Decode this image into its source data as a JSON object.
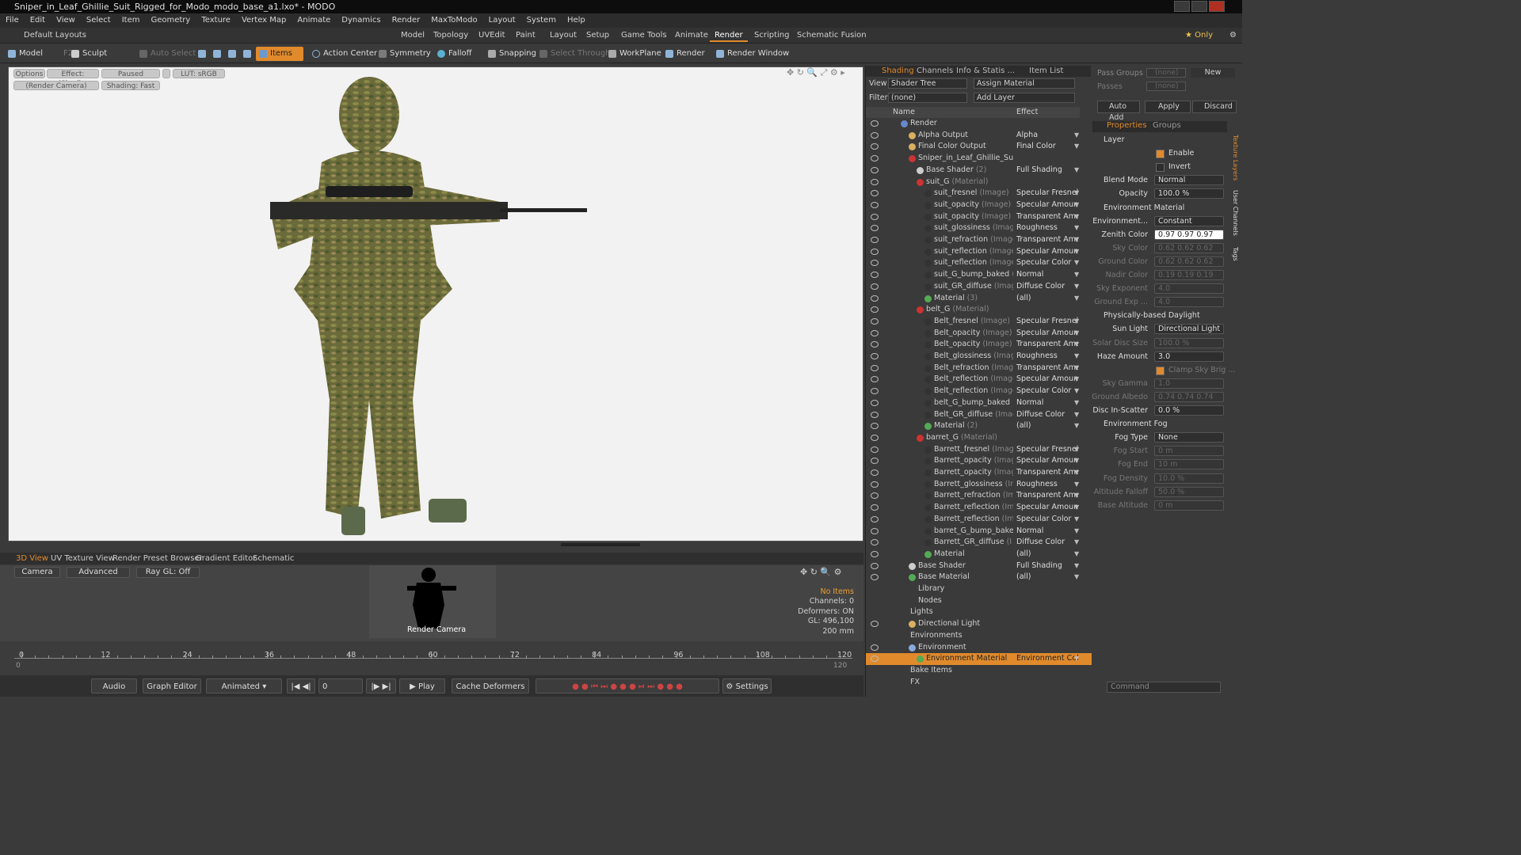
{
  "window": {
    "title": "Sniper_in_Leaf_Ghillie_Suit_Rigged_for_Modo_modo_base_a1.lxo* - MODO"
  },
  "menu": [
    "File",
    "Edit",
    "View",
    "Select",
    "Item",
    "Geometry",
    "Texture",
    "Vertex Map",
    "Animate",
    "Dynamics",
    "Render",
    "MaxToModo",
    "Layout",
    "System",
    "Help"
  ],
  "layouts": {
    "default": "Default Layouts",
    "tabs": [
      "Model",
      "Topology",
      "UVEdit",
      "Paint",
      "Layout",
      "Setup",
      "Game Tools",
      "Animate",
      "Render",
      "Scripting",
      "Schematic Fusion"
    ],
    "active": "Render",
    "only": "Only"
  },
  "toolbar": {
    "model": "Model",
    "f2": "F2",
    "sculpt": "Sculpt",
    "auto_select": "Auto Select",
    "items": "Items",
    "action_center": "Action Center",
    "symmetry": "Symmetry",
    "falloff": "Falloff",
    "snapping": "Snapping",
    "select_through": "Select Through",
    "workplane": "WorkPlane",
    "render": "Render",
    "render_window": "Render Window"
  },
  "viewport": {
    "options": "Options",
    "effect": "Effect: (Shadi...",
    "paused": "Paused",
    "lut": "LUT: sRGB",
    "camera": "(Render Camera)",
    "shading": "Shading: Fast"
  },
  "bottom_tabs": [
    "3D View",
    "UV Texture View",
    "Render Preset Browser",
    "Gradient Editor",
    "Schematic"
  ],
  "bottom": {
    "camera": "Camera",
    "advanced": "Advanced",
    "raygl": "Ray GL: Off",
    "render_camera": "Render Camera",
    "info": [
      "No Items",
      "Channels: 0",
      "Deformers: ON",
      "GL: 496,100",
      "200 mm"
    ]
  },
  "timeline": {
    "ticks": [
      "0",
      "12",
      "24",
      "36",
      "48",
      "60",
      "72",
      "84",
      "96",
      "108",
      "120"
    ],
    "ticks_bottom": [
      "0",
      "120"
    ]
  },
  "playbar": {
    "audio": "Audio",
    "graph_editor": "Graph Editor",
    "animated": "Animated",
    "frame": "0",
    "play": "Play",
    "cache": "Cache Deformers",
    "settings": "Settings"
  },
  "shading": {
    "tabs": [
      "Shading",
      "Channels",
      "Info & Statis ...",
      "Item List"
    ],
    "view_label": "View",
    "view_value": "Shader Tree",
    "assign": "Assign Material",
    "filter_label": "Filter",
    "filter_value": "(none)",
    "add_layer": "Add Layer",
    "col_name": "Name",
    "col_effect": "Effect",
    "rows": [
      {
        "name": "Render",
        "sub": "",
        "effect": "",
        "indent": 0,
        "icon": "#6688cc"
      },
      {
        "name": "Alpha Output",
        "sub": "",
        "effect": "Alpha",
        "indent": 1,
        "icon": "#d8b060"
      },
      {
        "name": "Final Color Output",
        "sub": "",
        "effect": "Final Color",
        "indent": 1,
        "icon": "#d8b060"
      },
      {
        "name": "Sniper_in_Leaf_Ghillie_Suit ...",
        "sub": "",
        "effect": "",
        "indent": 1,
        "icon": "#cc3333"
      },
      {
        "name": "Base Shader",
        "sub": "(2)",
        "effect": "Full Shading",
        "indent": 2,
        "icon": "#cccccc"
      },
      {
        "name": "suit_G",
        "sub": "(Material)",
        "effect": "",
        "indent": 2,
        "icon": "#cc3333"
      },
      {
        "name": "suit_fresnel",
        "sub": "(Image)",
        "effect": "Specular Fresnel",
        "indent": 3,
        "icon": "#333"
      },
      {
        "name": "suit_opacity",
        "sub": "(Image) (2)",
        "effect": "Specular Amount",
        "indent": 3,
        "icon": "#333"
      },
      {
        "name": "suit_opacity",
        "sub": "(Image)",
        "effect": "Transparent Amo ...",
        "indent": 3,
        "icon": "#333"
      },
      {
        "name": "suit_glossiness",
        "sub": "(Image)",
        "effect": "Roughness",
        "indent": 3,
        "icon": "#333"
      },
      {
        "name": "suit_refraction",
        "sub": "(Image)",
        "effect": "Transparent Amo ...",
        "indent": 3,
        "icon": "#333"
      },
      {
        "name": "suit_reflection",
        "sub": "(Image)...",
        "effect": "Specular Amount",
        "indent": 3,
        "icon": "#333"
      },
      {
        "name": "suit_reflection",
        "sub": "(Image)",
        "effect": "Specular Color",
        "indent": 3,
        "icon": "#333"
      },
      {
        "name": "suit_G_bump_baked",
        "sub": "(I...",
        "effect": "Normal",
        "indent": 3,
        "icon": "#333"
      },
      {
        "name": "suit_GR_diffuse",
        "sub": "(Image)",
        "effect": "Diffuse Color",
        "indent": 3,
        "icon": "#333"
      },
      {
        "name": "Material",
        "sub": "(3)",
        "effect": "(all)",
        "indent": 3,
        "icon": "#55aa55"
      },
      {
        "name": "belt_G",
        "sub": "(Material)",
        "effect": "",
        "indent": 2,
        "icon": "#cc3333"
      },
      {
        "name": "Belt_fresnel",
        "sub": "(Image)",
        "effect": "Specular Fresnel",
        "indent": 3,
        "icon": "#333"
      },
      {
        "name": "Belt_opacity",
        "sub": "(Image) (2)",
        "effect": "Specular Amount",
        "indent": 3,
        "icon": "#333"
      },
      {
        "name": "Belt_opacity",
        "sub": "(Image)",
        "effect": "Transparent Amo ...",
        "indent": 3,
        "icon": "#333"
      },
      {
        "name": "Belt_glossiness",
        "sub": "(Image)",
        "effect": "Roughness",
        "indent": 3,
        "icon": "#333"
      },
      {
        "name": "Belt_refraction",
        "sub": "(Image)",
        "effect": "Transparent Amo ...",
        "indent": 3,
        "icon": "#333"
      },
      {
        "name": "Belt_reflection",
        "sub": "(Image ...",
        "effect": "Specular Amount",
        "indent": 3,
        "icon": "#333"
      },
      {
        "name": "Belt_reflection",
        "sub": "(Image)",
        "effect": "Specular Color",
        "indent": 3,
        "icon": "#333"
      },
      {
        "name": "belt_G_bump_baked",
        "sub": "(I...",
        "effect": "Normal",
        "indent": 3,
        "icon": "#333"
      },
      {
        "name": "Belt_GR_diffuse",
        "sub": "(Image)",
        "effect": "Diffuse Color",
        "indent": 3,
        "icon": "#333"
      },
      {
        "name": "Material",
        "sub": "(2)",
        "effect": "(all)",
        "indent": 3,
        "icon": "#55aa55"
      },
      {
        "name": "barret_G",
        "sub": "(Material)",
        "effect": "",
        "indent": 2,
        "icon": "#cc3333"
      },
      {
        "name": "Barrett_fresnel",
        "sub": "(Image)",
        "effect": "Specular Fresnel",
        "indent": 3,
        "icon": "#333"
      },
      {
        "name": "Barrett_opacity",
        "sub": "(Imag ...",
        "effect": "Specular Amount",
        "indent": 3,
        "icon": "#333"
      },
      {
        "name": "Barrett_opacity",
        "sub": "(Image)",
        "effect": "Transparent Amo ...",
        "indent": 3,
        "icon": "#333"
      },
      {
        "name": "Barrett_glossiness",
        "sub": "(Im ...",
        "effect": "Roughness",
        "indent": 3,
        "icon": "#333"
      },
      {
        "name": "Barrett_refraction",
        "sub": "(Im ...",
        "effect": "Transparent Amo ...",
        "indent": 3,
        "icon": "#333"
      },
      {
        "name": "Barrett_reflection",
        "sub": "(Im ...",
        "effect": "Specular Amount",
        "indent": 3,
        "icon": "#333"
      },
      {
        "name": "Barrett_reflection",
        "sub": "(Im ...",
        "effect": "Specular Color",
        "indent": 3,
        "icon": "#333"
      },
      {
        "name": "barret_G_bump_bake ...",
        "sub": "",
        "effect": "Normal",
        "indent": 3,
        "icon": "#333"
      },
      {
        "name": "Barrett_GR_diffuse",
        "sub": "(I ...",
        "effect": "Diffuse Color",
        "indent": 3,
        "icon": "#333"
      },
      {
        "name": "Material",
        "sub": "",
        "effect": "(all)",
        "indent": 3,
        "icon": "#55aa55"
      },
      {
        "name": "Base Shader",
        "sub": "",
        "effect": "Full Shading",
        "indent": 1,
        "icon": "#cccccc"
      },
      {
        "name": "Base Material",
        "sub": "",
        "effect": "(all)",
        "indent": 1,
        "icon": "#55aa55"
      },
      {
        "name": "Library",
        "sub": "",
        "effect": "",
        "indent": 1,
        "icon": ""
      },
      {
        "name": "Nodes",
        "sub": "",
        "effect": "",
        "indent": 1,
        "icon": ""
      },
      {
        "name": "Lights",
        "sub": "",
        "effect": "",
        "indent": 0,
        "icon": ""
      },
      {
        "name": "Directional Light",
        "sub": "",
        "effect": "",
        "indent": 1,
        "icon": "#d8b060"
      },
      {
        "name": "Environments",
        "sub": "",
        "effect": "",
        "indent": 0,
        "icon": ""
      },
      {
        "name": "Environment",
        "sub": "",
        "effect": "",
        "indent": 1,
        "icon": "#88aadd"
      },
      {
        "name": "Environment Material",
        "sub": "",
        "effect": "Environment Color",
        "indent": 2,
        "icon": "#55aa55"
      },
      {
        "name": "Bake Items",
        "sub": "",
        "effect": "",
        "indent": 0,
        "icon": ""
      },
      {
        "name": "FX",
        "sub": "",
        "effect": "",
        "indent": 0,
        "icon": ""
      }
    ]
  },
  "props": {
    "pass_groups": "Pass Groups",
    "pass_groups_value": "(none)",
    "new": "New",
    "passes": "Passes",
    "passes_value": "(none)",
    "auto_add": "Auto Add",
    "apply": "Apply",
    "discard": "Discard",
    "tabs": [
      "Properties",
      "Groups"
    ],
    "vtabs": [
      "Texture Layers",
      "User Channels",
      "Tags"
    ],
    "command": "Command",
    "rows": [
      {
        "type": "hdr",
        "label": "Layer"
      },
      {
        "type": "check",
        "label": "Enable",
        "checked": true
      },
      {
        "type": "check",
        "label": "Invert",
        "checked": false
      },
      {
        "type": "field",
        "label": "Blend Mode",
        "value": "Normal"
      },
      {
        "type": "field",
        "label": "Opacity",
        "value": "100.0 %"
      },
      {
        "type": "hdr",
        "label": "Environment Material"
      },
      {
        "type": "field",
        "label": "Environment...",
        "value": "Constant"
      },
      {
        "type": "field",
        "label": "Zenith Color",
        "value": "0.97  0.97  0.97",
        "light": true
      },
      {
        "type": "field",
        "label": "Sky Color",
        "value": "0.62  0.62  0.62",
        "dim": true
      },
      {
        "type": "field",
        "label": "Ground Color",
        "value": "0.62  0.62  0.62",
        "dim": true
      },
      {
        "type": "field",
        "label": "Nadir Color",
        "value": "0.19  0.19  0.19",
        "dim": true
      },
      {
        "type": "field",
        "label": "Sky Exponent",
        "value": "4.0",
        "dim": true
      },
      {
        "type": "field",
        "label": "Ground Exp ...",
        "value": "4.0",
        "dim": true
      },
      {
        "type": "hdr",
        "label": "Physically-based Daylight"
      },
      {
        "type": "field",
        "label": "Sun Light",
        "value": "Directional Light"
      },
      {
        "type": "field",
        "label": "Solar Disc Size",
        "value": "100.0 %",
        "dim": true
      },
      {
        "type": "field",
        "label": "Haze Amount",
        "value": "3.0"
      },
      {
        "type": "check",
        "label": "Clamp Sky Brig ...",
        "checked": true,
        "dim": true
      },
      {
        "type": "field",
        "label": "Sky Gamma",
        "value": "1.0",
        "dim": true
      },
      {
        "type": "field",
        "label": "Ground Albedo",
        "value": "0.74  0.74  0.74",
        "dim": true
      },
      {
        "type": "field",
        "label": "Disc In-Scatter",
        "value": "0.0 %"
      },
      {
        "type": "hdr",
        "label": "Environment Fog"
      },
      {
        "type": "field",
        "label": "Fog Type",
        "value": "None"
      },
      {
        "type": "field",
        "label": "Fog Start",
        "value": "0 m",
        "dim": true
      },
      {
        "type": "field",
        "label": "Fog End",
        "value": "10 m",
        "dim": true
      },
      {
        "type": "field",
        "label": "Fog Density",
        "value": "10.0 %",
        "dim": true
      },
      {
        "type": "field",
        "label": "Altitude Falloff",
        "value": "50.0 %",
        "dim": true
      },
      {
        "type": "field",
        "label": "Base Altitude",
        "value": "0 m",
        "dim": true
      }
    ]
  },
  "colors": {
    "accent": "#e08a2c",
    "viewport_bg": "#f2f2f2"
  }
}
